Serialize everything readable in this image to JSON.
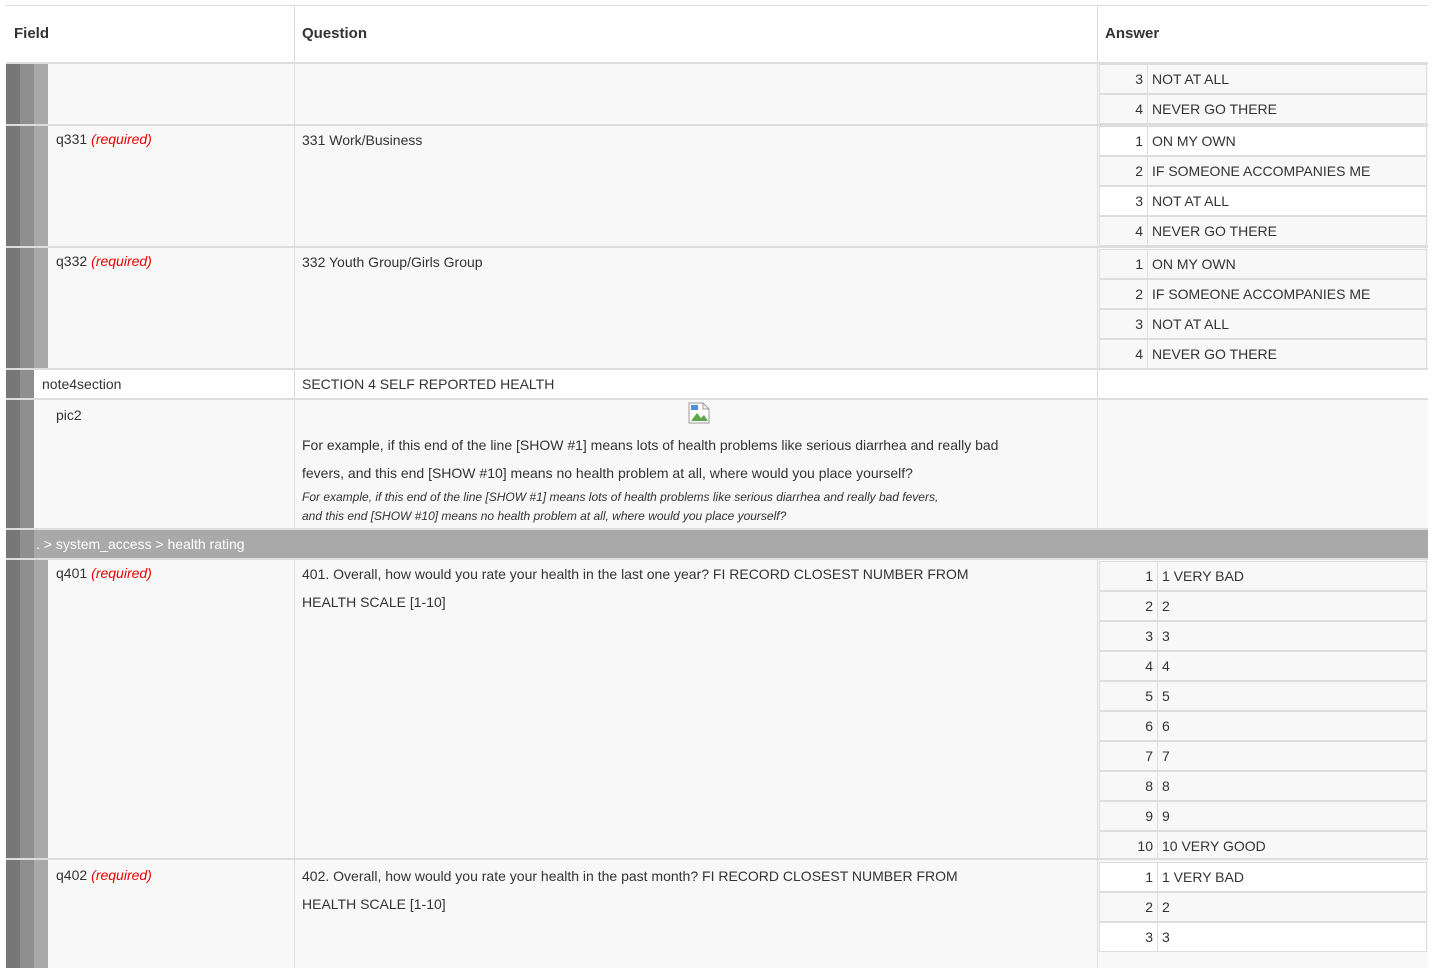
{
  "header": {
    "field": "Field",
    "question": "Question",
    "answer": "Answer"
  },
  "row_prev": {
    "choices": [
      {
        "value": "3",
        "label": "NOT AT ALL"
      },
      {
        "value": "4",
        "label": "NEVER GO THERE"
      }
    ]
  },
  "q331": {
    "name": "q331",
    "required": "(required)",
    "question": "331 Work/Business",
    "choices": [
      {
        "value": "1",
        "label": "ON MY OWN"
      },
      {
        "value": "2",
        "label": "IF SOMEONE ACCOMPANIES ME"
      },
      {
        "value": "3",
        "label": "NOT AT ALL"
      },
      {
        "value": "4",
        "label": "NEVER GO THERE"
      }
    ]
  },
  "q332": {
    "name": "q332",
    "required": "(required)",
    "question": "332 Youth Group/Girls Group",
    "choices": [
      {
        "value": "1",
        "label": "ON MY OWN"
      },
      {
        "value": "2",
        "label": "IF SOMEONE ACCOMPANIES ME"
      },
      {
        "value": "3",
        "label": "NOT AT ALL"
      },
      {
        "value": "4",
        "label": "NEVER GO THERE"
      }
    ]
  },
  "note4section": {
    "name": "note4section",
    "question": "SECTION 4 SELF REPORTED HEALTH"
  },
  "pic2": {
    "name": "pic2",
    "question_line1": "For example, if this end of the line [SHOW #1] means lots of health problems like serious diarrhea and really bad",
    "question_line2": "fevers, and this end [SHOW #10] means no health problem at all, where would you place yourself?",
    "hint_line1": "For example, if this end of the line [SHOW #1] means lots of health problems like serious diarrhea and really bad fevers,",
    "hint_line2": "and this end [SHOW #10] means no health problem at all, where would you place yourself?"
  },
  "group": {
    "path": ". > system_access > health rating"
  },
  "q401": {
    "name": "q401",
    "required": "(required)",
    "question_line1": "401. Overall, how would you rate your health in the last one year? FI RECORD CLOSEST NUMBER FROM",
    "question_line2": "HEALTH SCALE [1-10]",
    "choices": [
      {
        "value": "1",
        "label": "1 VERY BAD"
      },
      {
        "value": "2",
        "label": "2"
      },
      {
        "value": "3",
        "label": "3"
      },
      {
        "value": "4",
        "label": "4"
      },
      {
        "value": "5",
        "label": "5"
      },
      {
        "value": "6",
        "label": "6"
      },
      {
        "value": "7",
        "label": "7"
      },
      {
        "value": "8",
        "label": "8"
      },
      {
        "value": "9",
        "label": "9"
      },
      {
        "value": "10",
        "label": "10 VERY GOOD"
      }
    ]
  },
  "q402": {
    "name": "q402",
    "required": "(required)",
    "question_line1": "402. Overall, how would you rate your health in the past month? FI RECORD CLOSEST NUMBER FROM",
    "question_line2": "HEALTH SCALE [1-10]",
    "choices": [
      {
        "value": "1",
        "label": "1 VERY BAD"
      },
      {
        "value": "2",
        "label": "2"
      },
      {
        "value": "3",
        "label": "3"
      }
    ]
  }
}
